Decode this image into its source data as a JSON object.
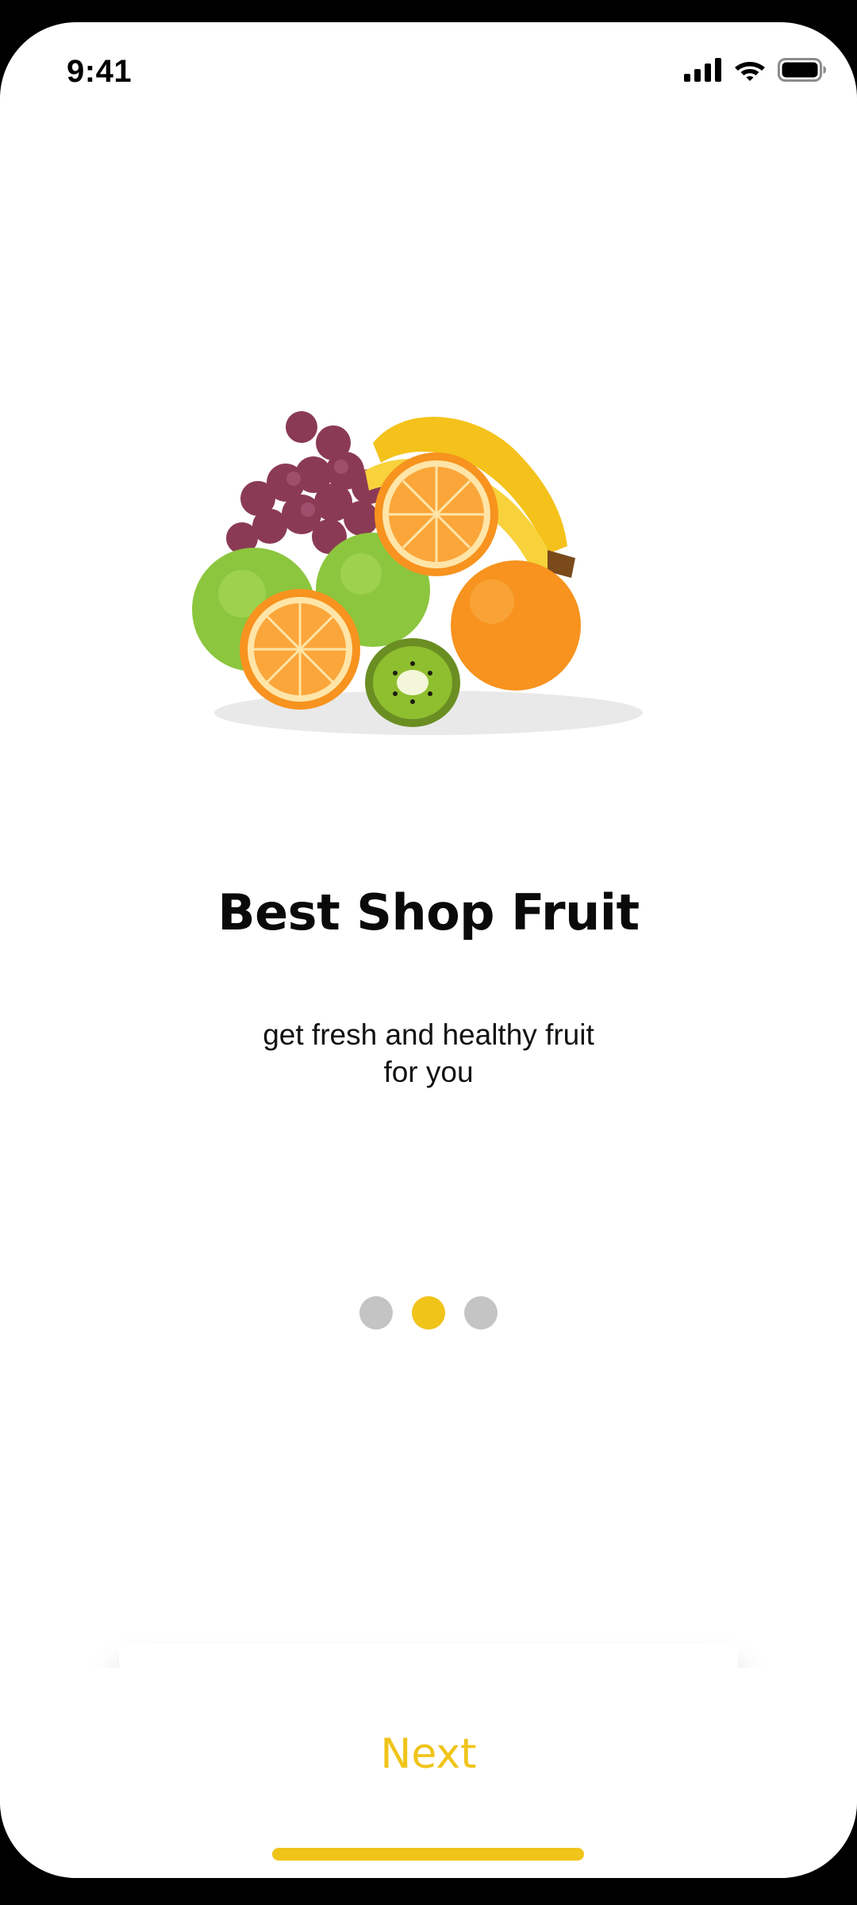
{
  "status_bar": {
    "time": "9:41",
    "icons": [
      "signal-icon",
      "wifi-icon",
      "battery-icon"
    ]
  },
  "hero_image": {
    "subject": "fruit-assortment"
  },
  "content": {
    "title": "Best Shop Fruit",
    "subtitle_line1": "get fresh and healthy fruit",
    "subtitle_line2": "for you"
  },
  "pager": {
    "count": 3,
    "active_index": 1
  },
  "actions": {
    "next_label": "Next"
  },
  "colors": {
    "accent": "#f0c419",
    "dot_inactive": "#c4c4c4",
    "background": "#ffffff",
    "text": "#0a0a0a"
  }
}
